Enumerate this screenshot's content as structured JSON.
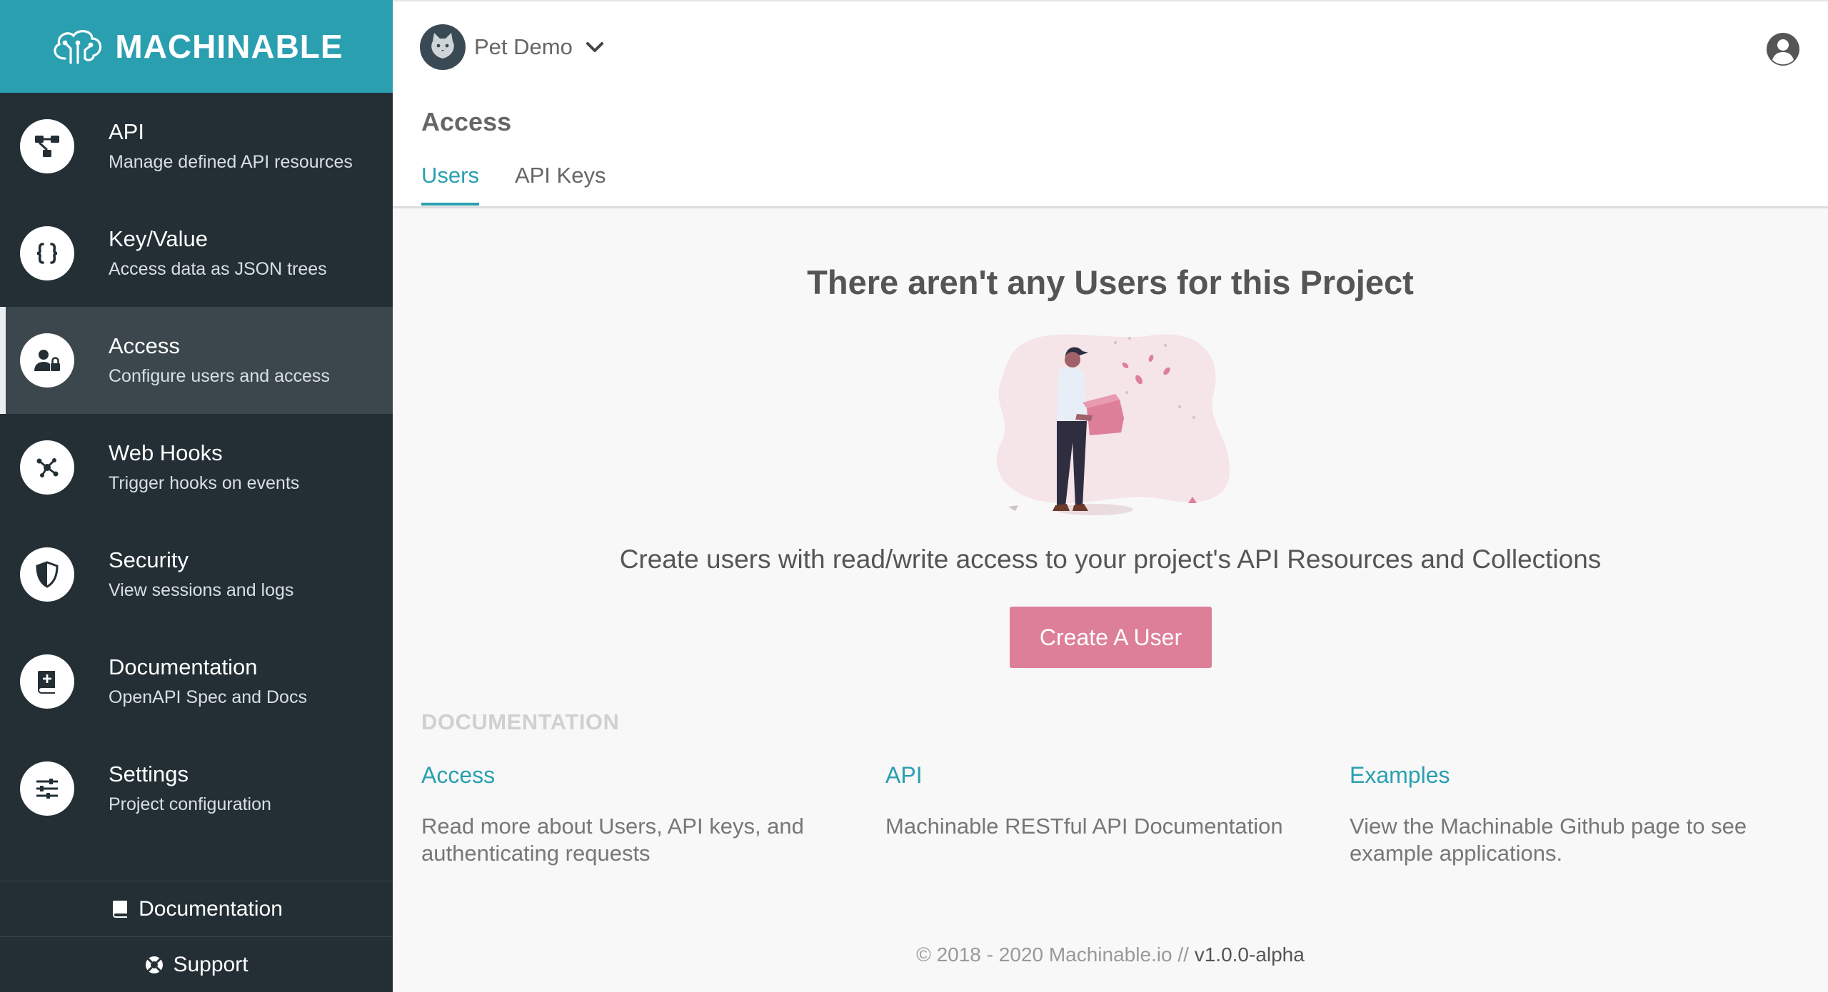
{
  "brand": {
    "name": "MACHINABLE",
    "color": "#2a9fb0"
  },
  "sidebar": {
    "items": [
      {
        "title": "API",
        "subtitle": "Manage defined API resources",
        "icon": "api-icon"
      },
      {
        "title": "Key/Value",
        "subtitle": "Access data as JSON trees",
        "icon": "braces-icon"
      },
      {
        "title": "Access",
        "subtitle": "Configure users and access",
        "icon": "user-lock-icon",
        "active": true
      },
      {
        "title": "Web Hooks",
        "subtitle": "Trigger hooks on events",
        "icon": "webhook-icon"
      },
      {
        "title": "Security",
        "subtitle": "View sessions and logs",
        "icon": "shield-icon"
      },
      {
        "title": "Documentation",
        "subtitle": "OpenAPI Spec and Docs",
        "icon": "book-icon"
      },
      {
        "title": "Settings",
        "subtitle": "Project configuration",
        "icon": "sliders-icon"
      }
    ],
    "footer": {
      "documentation": "Documentation",
      "support": "Support"
    }
  },
  "header": {
    "project_name": "Pet Demo",
    "page_title": "Access",
    "tabs": [
      {
        "label": "Users",
        "active": true
      },
      {
        "label": "API Keys",
        "active": false
      }
    ]
  },
  "empty_state": {
    "title": "There aren't any Users for this Project",
    "description": "Create users with read/write access to your project's API Resources and Collections",
    "button": "Create A User",
    "button_color": "#dd7f98"
  },
  "docs": {
    "section_title": "DOCUMENTATION",
    "links": [
      {
        "title": "Access",
        "description": "Read more about Users, API keys, and authenticating requests"
      },
      {
        "title": "API",
        "description": "Machinable RESTful API Documentation"
      },
      {
        "title": "Examples",
        "description": "View the Machinable Github page to see example applications."
      }
    ]
  },
  "footer": {
    "copyright": "© 2018 - 2020 Machinable.io // ",
    "version": "v1.0.0-alpha"
  }
}
